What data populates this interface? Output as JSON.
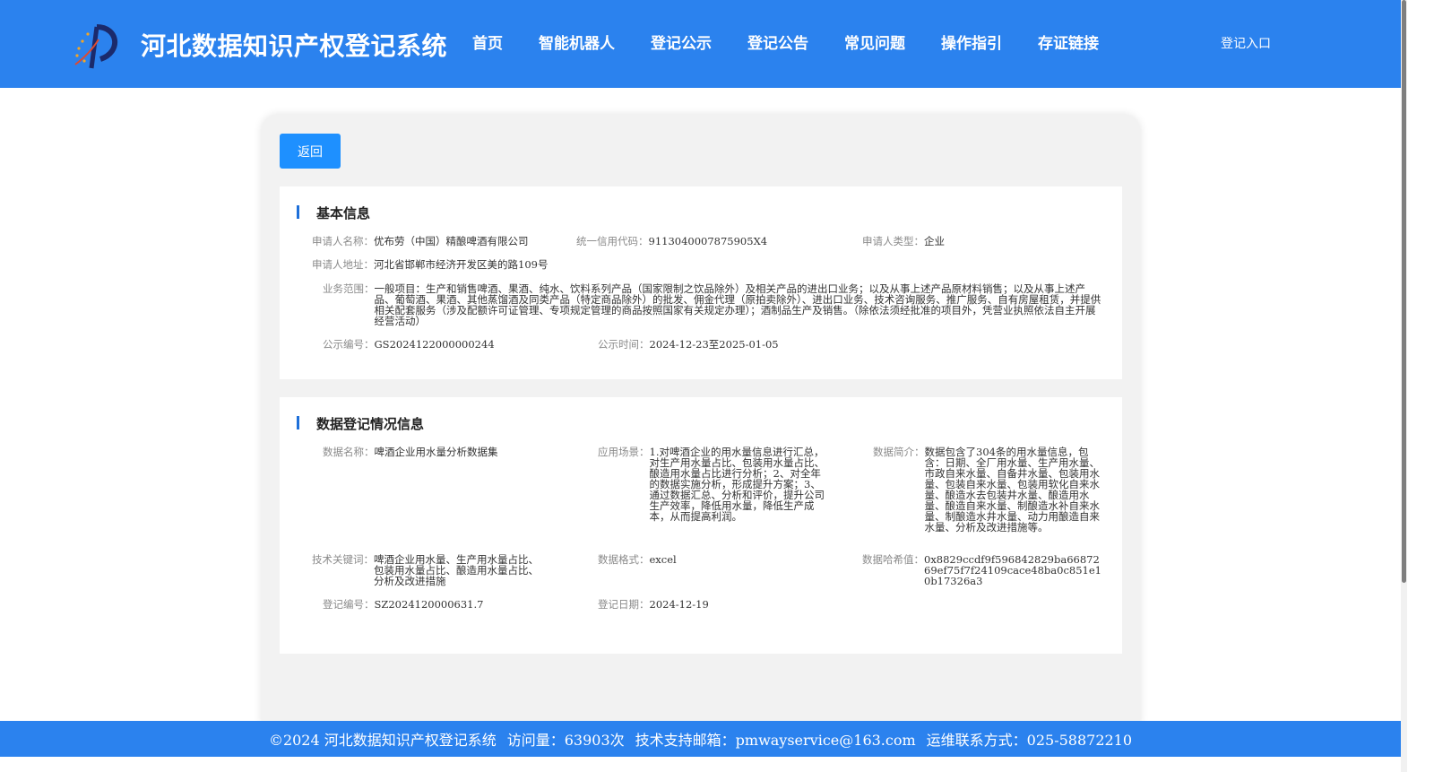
{
  "header": {
    "title": "河北数据知识产权登记系统",
    "nav": [
      "首页",
      "智能机器人",
      "登记公示",
      "登记公告",
      "常见问题",
      "操作指引",
      "存证链接"
    ],
    "login": "登记入口"
  },
  "back_label": "返回",
  "basic": {
    "title": "基本信息",
    "applicant_name_label": "申请人名称：",
    "applicant_name": "优布劳（中国）精酿啤酒有限公司",
    "credit_code_label": "统一信用代码：",
    "credit_code": "9113040007875905X4",
    "applicant_type_label": "申请人类型：",
    "applicant_type": "企业",
    "address_label": "申请人地址：",
    "address": "河北省邯郸市经济开发区美的路109号",
    "scope_label": "业务范围：",
    "scope": "一般项目：生产和销售啤酒、果酒、纯水、饮料系列产品（国家限制之饮品除外）及相关产品的进出口业务；以及从事上述产品原材料销售；以及从事上述产品、葡萄酒、果酒、其他蒸馏酒及同类产品（特定商品除外）的批发、佣金代理（原拍卖除外）、进出口业务、技术咨询服务、推广服务、自有房屋租赁，并提供相关配套服务（涉及配额许可证管理、专项规定管理的商品按照国家有关规定办理）；酒制品生产及销售。（除依法须经批准的项目外，凭营业执照依法自主开展经营活动）",
    "notice_no_label": "公示编号：",
    "notice_no": "GS2024122000000244",
    "notice_time_label": "公示时间：",
    "notice_time": "2024-12-23至2025-01-05"
  },
  "data_reg": {
    "title": "数据登记情况信息",
    "name_label": "数据名称：",
    "name": "啤酒企业用水量分析数据集",
    "scene_label": "应用场景：",
    "scene": "1.对啤酒企业的用水量信息进行汇总，对生产用水量占比、包装用水量占比、酿造用水量占比进行分析；2、对全年的数据实施分析，形成提升方案；3、通过数据汇总、分析和评价，提升公司生产效率，降低用水量，降低生产成本，从而提高利润。",
    "intro_label": "数据简介：",
    "intro": "数据包含了304条的用水量信息，包含：日期、全厂用水量、生产用水量、市政自来水量、自备井水量、包装用水量、包装自来水量、包装用软化自来水量、酿造水去包装井水量、酿造用水量、酿造自来水量、制酿造水补自来水量、制酿造水井水量、动力用酿造自来水量、分析及改进措施等。",
    "keywords_label": "技术关键词：",
    "keywords": "啤酒企业用水量、生产用水量占比、包装用水量占比、酿造用水量占比、分析及改进措施",
    "format_label": "数据格式：",
    "format": "excel",
    "hash_label": "数据哈希值：",
    "hash": "0x8829ccdf9f596842829ba6687269ef75f7f24109cace48ba0c851e10b17326a3",
    "reg_no_label": "登记编号：",
    "reg_no": "SZ2024120000631.7",
    "reg_date_label": "登记日期：",
    "reg_date": "2024-12-19"
  },
  "footer": {
    "copyright": "©2024 河北数据知识产权登记系统",
    "visits": "访问量：63903次",
    "email": "技术支持邮箱：pmwayservice@163.com",
    "phone": "运维联系方式：025-58872210"
  },
  "colors": {
    "primary": "#2b82ee",
    "button": "#1e90ff",
    "accent_bar": "#1e6fd9"
  }
}
